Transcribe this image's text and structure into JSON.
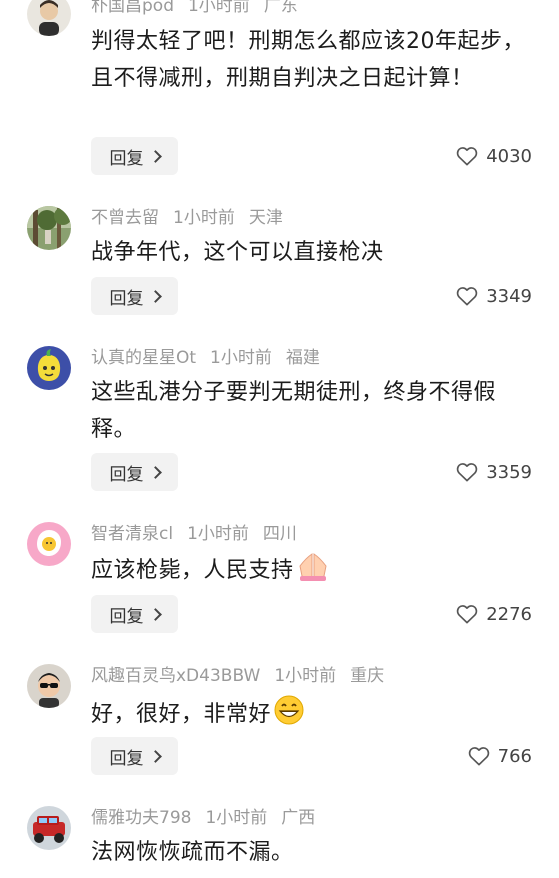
{
  "reply_label": "回复",
  "comments": [
    {
      "username": "朴国昌pod",
      "time": "1小时前",
      "location": "广东",
      "text": "判得太轻了吧！刑期怎么都应该20年起步，且不得减刑，刑期自判决之日起计算！",
      "likes": "4030",
      "avatar": "man-light-avatar"
    },
    {
      "username": "不曾去留",
      "time": "1小时前",
      "location": "天津",
      "text": "战争年代，这个可以直接枪决",
      "likes": "3349",
      "avatar": "forest-avatar"
    },
    {
      "username": "认真的星星Ot",
      "time": "1小时前",
      "location": "福建",
      "text": "这些乱港分子要判无期徒刑，终身不得假释。",
      "likes": "3359",
      "avatar": "lemon-avatar"
    },
    {
      "username": "智者清泉cl",
      "time": "1小时前",
      "location": "四川",
      "text": "应该枪毙，人民支持",
      "likes": "2276",
      "avatar": "pink-egg-avatar",
      "emoji": "praying-hands-emoji"
    },
    {
      "username": "风趣百灵鸟xD43BBW",
      "time": "1小时前",
      "location": "重庆",
      "text": "好，很好，非常好",
      "likes": "766",
      "avatar": "man-sunglasses-avatar",
      "emoji": "grinning-face-emoji"
    },
    {
      "username": "儒雅功夫798",
      "time": "1小时前",
      "location": "广西",
      "text": "法网恢恢疏而不漏。",
      "avatar": "red-jeep-avatar"
    }
  ]
}
